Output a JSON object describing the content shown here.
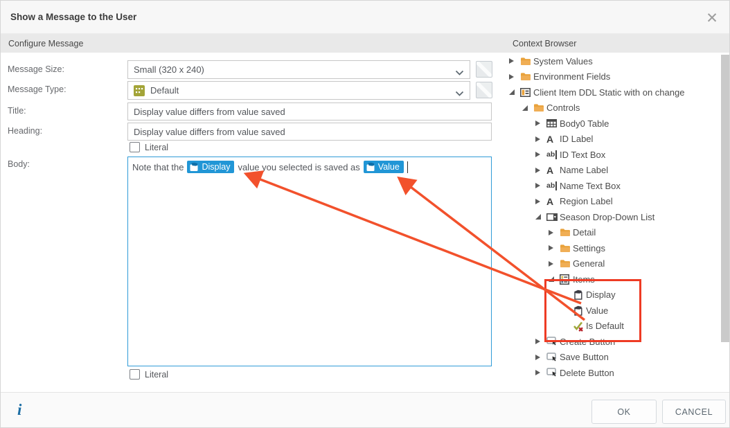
{
  "dialog": {
    "title": "Show a Message to the User"
  },
  "panels": {
    "configure_header": "Configure Message",
    "context_header": "Context Browser"
  },
  "form": {
    "message_size_label": "Message Size:",
    "message_size_value": "Small (320 x 240)",
    "message_type_label": "Message Type:",
    "message_type_value": "Default",
    "title_label": "Title:",
    "title_value": "Display value differs from value saved",
    "heading_label": "Heading:",
    "heading_value": "Display value differs from value saved",
    "literal_label": "Literal",
    "body_label": "Body:",
    "body": {
      "text_before": "Note that the",
      "token_display": "Display",
      "text_between": "value you selected is saved as",
      "token_value": "Value"
    }
  },
  "tree": {
    "items": [
      {
        "label": "System Values",
        "icon": "folder",
        "state": "collapsed"
      },
      {
        "label": "Environment Fields",
        "icon": "folder",
        "state": "collapsed"
      },
      {
        "label": "Client Item DDL Static with on change",
        "icon": "view",
        "state": "expanded"
      },
      {
        "label": "Controls",
        "icon": "folder",
        "state": "expanded"
      },
      {
        "label": "Body0 Table",
        "icon": "table",
        "state": "collapsed"
      },
      {
        "label": "ID Label",
        "icon": "label",
        "state": "collapsed"
      },
      {
        "label": "ID Text Box",
        "icon": "textbox",
        "state": "collapsed"
      },
      {
        "label": "Name Label",
        "icon": "label",
        "state": "collapsed"
      },
      {
        "label": "Name Text Box",
        "icon": "textbox",
        "state": "collapsed"
      },
      {
        "label": "Region Label",
        "icon": "label",
        "state": "collapsed"
      },
      {
        "label": "Season Drop-Down List",
        "icon": "dropdown",
        "state": "expanded"
      },
      {
        "label": "Detail",
        "icon": "folder",
        "state": "collapsed"
      },
      {
        "label": "Settings",
        "icon": "folder",
        "state": "collapsed"
      },
      {
        "label": "General",
        "icon": "folder",
        "state": "collapsed"
      },
      {
        "label": "Items",
        "icon": "items-list",
        "state": "expanded"
      },
      {
        "label": "Display",
        "icon": "property",
        "state": "leaf"
      },
      {
        "label": "Value",
        "icon": "property",
        "state": "leaf"
      },
      {
        "label": "Is Default",
        "icon": "check-cross",
        "state": "leaf"
      },
      {
        "label": "Create Button",
        "icon": "button",
        "state": "collapsed"
      },
      {
        "label": "Save Button",
        "icon": "button",
        "state": "collapsed"
      },
      {
        "label": "Delete Button",
        "icon": "button",
        "state": "collapsed"
      }
    ]
  },
  "footer": {
    "ok_label": "OK",
    "cancel_label": "CANCEL"
  },
  "icons": {
    "close": "✕",
    "info": "i"
  },
  "colors": {
    "token_blue": "#2196D6",
    "body_border_blue": "#2F9BD7",
    "annotation_red": "#F2512C",
    "highlight_red": "#EE3B24",
    "folder_orange": "#E9A23B",
    "type_olive": "#A3A438",
    "header_gray": "#E9E9E9"
  }
}
